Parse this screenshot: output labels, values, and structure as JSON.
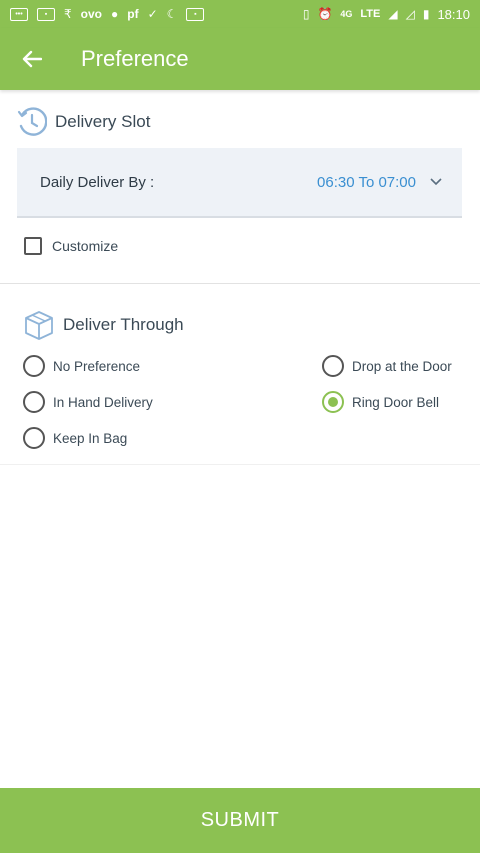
{
  "status_bar": {
    "network": "4G",
    "lte": "LTE",
    "time": "18:10",
    "icons": [
      "message-icon",
      "paytm-icon",
      "rupee-icon",
      "ovo-icon",
      "chat-icon",
      "pf-icon",
      "check-icon",
      "moon-icon",
      "paytm-icon",
      "vibrate-icon",
      "alarm-icon",
      "wifi-call-icon",
      "signal-icon",
      "battery-icon"
    ],
    "ovo_text": "ovo",
    "pf_text": "pf"
  },
  "app_bar": {
    "title": "Preference"
  },
  "delivery_slot": {
    "title": "Delivery Slot",
    "label": "Daily Deliver By :",
    "value": "06:30 To 07:00"
  },
  "customize": {
    "label": "Customize",
    "checked": false
  },
  "deliver_through": {
    "title": "Deliver Through",
    "options": [
      {
        "label": "No Preference",
        "checked": false
      },
      {
        "label": "Drop at the Door",
        "checked": false
      },
      {
        "label": "In Hand Delivery",
        "checked": false
      },
      {
        "label": "Ring Door Bell",
        "checked": true
      },
      {
        "label": "Keep In Bag",
        "checked": false
      }
    ]
  },
  "submit": {
    "label": "SUBMIT"
  },
  "colors": {
    "accent": "#8cc152",
    "link": "#3a8fd1",
    "text": "#3b4a56"
  }
}
